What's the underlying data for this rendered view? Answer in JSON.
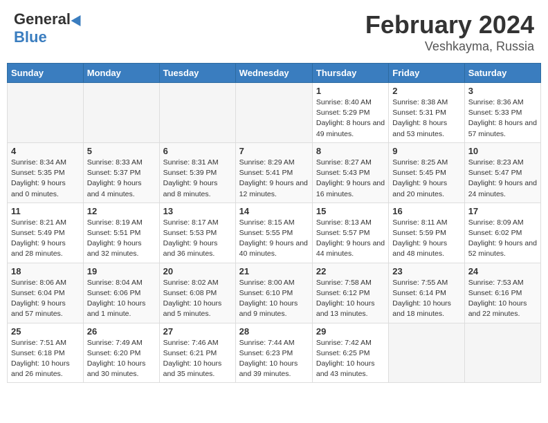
{
  "header": {
    "logo_general": "General",
    "logo_blue": "Blue",
    "title_month": "February 2024",
    "title_location": "Veshkayma, Russia"
  },
  "days_of_week": [
    "Sunday",
    "Monday",
    "Tuesday",
    "Wednesday",
    "Thursday",
    "Friday",
    "Saturday"
  ],
  "weeks": [
    [
      {
        "day": "",
        "info": ""
      },
      {
        "day": "",
        "info": ""
      },
      {
        "day": "",
        "info": ""
      },
      {
        "day": "",
        "info": ""
      },
      {
        "day": "1",
        "info": "Sunrise: 8:40 AM\nSunset: 5:29 PM\nDaylight: 8 hours and 49 minutes."
      },
      {
        "day": "2",
        "info": "Sunrise: 8:38 AM\nSunset: 5:31 PM\nDaylight: 8 hours and 53 minutes."
      },
      {
        "day": "3",
        "info": "Sunrise: 8:36 AM\nSunset: 5:33 PM\nDaylight: 8 hours and 57 minutes."
      }
    ],
    [
      {
        "day": "4",
        "info": "Sunrise: 8:34 AM\nSunset: 5:35 PM\nDaylight: 9 hours and 0 minutes."
      },
      {
        "day": "5",
        "info": "Sunrise: 8:33 AM\nSunset: 5:37 PM\nDaylight: 9 hours and 4 minutes."
      },
      {
        "day": "6",
        "info": "Sunrise: 8:31 AM\nSunset: 5:39 PM\nDaylight: 9 hours and 8 minutes."
      },
      {
        "day": "7",
        "info": "Sunrise: 8:29 AM\nSunset: 5:41 PM\nDaylight: 9 hours and 12 minutes."
      },
      {
        "day": "8",
        "info": "Sunrise: 8:27 AM\nSunset: 5:43 PM\nDaylight: 9 hours and 16 minutes."
      },
      {
        "day": "9",
        "info": "Sunrise: 8:25 AM\nSunset: 5:45 PM\nDaylight: 9 hours and 20 minutes."
      },
      {
        "day": "10",
        "info": "Sunrise: 8:23 AM\nSunset: 5:47 PM\nDaylight: 9 hours and 24 minutes."
      }
    ],
    [
      {
        "day": "11",
        "info": "Sunrise: 8:21 AM\nSunset: 5:49 PM\nDaylight: 9 hours and 28 minutes."
      },
      {
        "day": "12",
        "info": "Sunrise: 8:19 AM\nSunset: 5:51 PM\nDaylight: 9 hours and 32 minutes."
      },
      {
        "day": "13",
        "info": "Sunrise: 8:17 AM\nSunset: 5:53 PM\nDaylight: 9 hours and 36 minutes."
      },
      {
        "day": "14",
        "info": "Sunrise: 8:15 AM\nSunset: 5:55 PM\nDaylight: 9 hours and 40 minutes."
      },
      {
        "day": "15",
        "info": "Sunrise: 8:13 AM\nSunset: 5:57 PM\nDaylight: 9 hours and 44 minutes."
      },
      {
        "day": "16",
        "info": "Sunrise: 8:11 AM\nSunset: 5:59 PM\nDaylight: 9 hours and 48 minutes."
      },
      {
        "day": "17",
        "info": "Sunrise: 8:09 AM\nSunset: 6:02 PM\nDaylight: 9 hours and 52 minutes."
      }
    ],
    [
      {
        "day": "18",
        "info": "Sunrise: 8:06 AM\nSunset: 6:04 PM\nDaylight: 9 hours and 57 minutes."
      },
      {
        "day": "19",
        "info": "Sunrise: 8:04 AM\nSunset: 6:06 PM\nDaylight: 10 hours and 1 minute."
      },
      {
        "day": "20",
        "info": "Sunrise: 8:02 AM\nSunset: 6:08 PM\nDaylight: 10 hours and 5 minutes."
      },
      {
        "day": "21",
        "info": "Sunrise: 8:00 AM\nSunset: 6:10 PM\nDaylight: 10 hours and 9 minutes."
      },
      {
        "day": "22",
        "info": "Sunrise: 7:58 AM\nSunset: 6:12 PM\nDaylight: 10 hours and 13 minutes."
      },
      {
        "day": "23",
        "info": "Sunrise: 7:55 AM\nSunset: 6:14 PM\nDaylight: 10 hours and 18 minutes."
      },
      {
        "day": "24",
        "info": "Sunrise: 7:53 AM\nSunset: 6:16 PM\nDaylight: 10 hours and 22 minutes."
      }
    ],
    [
      {
        "day": "25",
        "info": "Sunrise: 7:51 AM\nSunset: 6:18 PM\nDaylight: 10 hours and 26 minutes."
      },
      {
        "day": "26",
        "info": "Sunrise: 7:49 AM\nSunset: 6:20 PM\nDaylight: 10 hours and 30 minutes."
      },
      {
        "day": "27",
        "info": "Sunrise: 7:46 AM\nSunset: 6:21 PM\nDaylight: 10 hours and 35 minutes."
      },
      {
        "day": "28",
        "info": "Sunrise: 7:44 AM\nSunset: 6:23 PM\nDaylight: 10 hours and 39 minutes."
      },
      {
        "day": "29",
        "info": "Sunrise: 7:42 AM\nSunset: 6:25 PM\nDaylight: 10 hours and 43 minutes."
      },
      {
        "day": "",
        "info": ""
      },
      {
        "day": "",
        "info": ""
      }
    ]
  ]
}
